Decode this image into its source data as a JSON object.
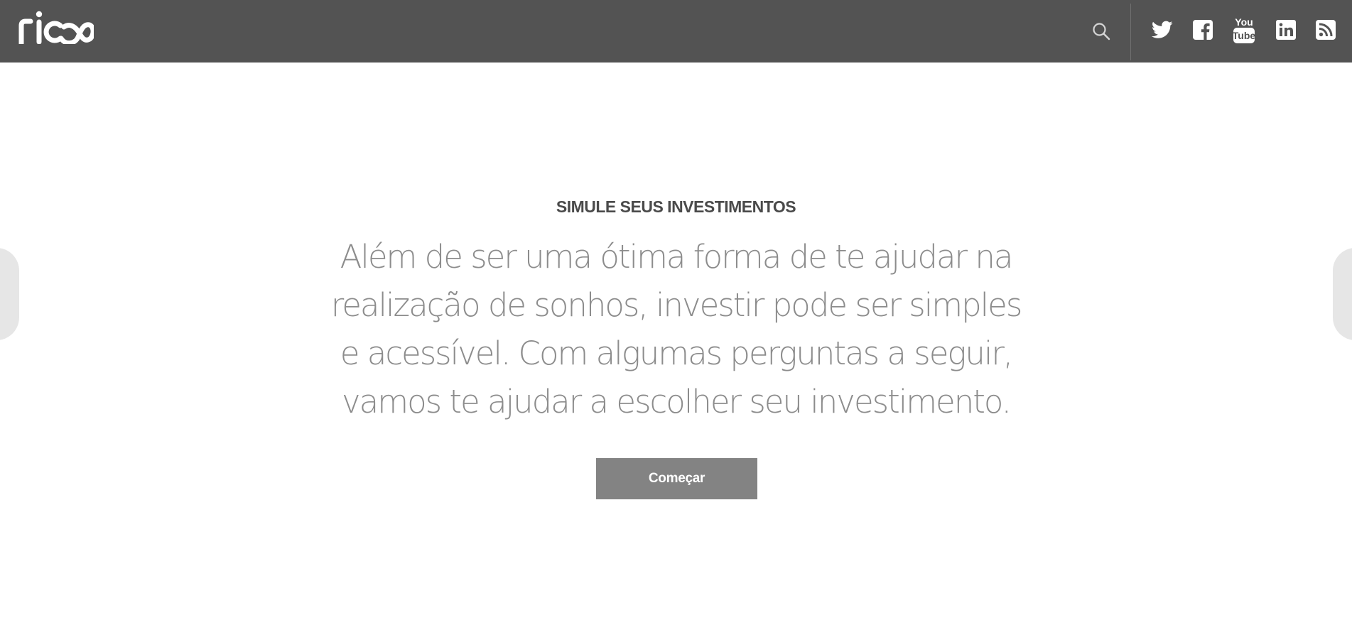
{
  "header": {
    "logo_text": "rico",
    "search_icon": "search-icon",
    "social": [
      {
        "name": "twitter",
        "icon": "twitter-icon"
      },
      {
        "name": "facebook",
        "icon": "facebook-icon",
        "glyph": "f"
      },
      {
        "name": "youtube",
        "icon": "youtube-icon",
        "line1": "You",
        "line2": "Tube"
      },
      {
        "name": "linkedin",
        "icon": "linkedin-icon",
        "glyph": "in"
      },
      {
        "name": "rss",
        "icon": "rss-icon"
      }
    ]
  },
  "hero": {
    "eyebrow": "SIMULE SEUS INVESTIMENTOS",
    "lines": [
      "Além de ser uma ótima forma de te ajudar na",
      "realização de sonhos, investir pode ser simples",
      "e acessível. Com algumas perguntas a seguir,",
      "vamos te ajudar a escolher seu investimento."
    ],
    "cta_label": "Começar"
  },
  "carousel": {
    "prev_icon": "chevron-left-icon",
    "next_icon": "chevron-right-icon"
  },
  "colors": {
    "header_bg": "#535353",
    "eyebrow": "#4a4a4a",
    "lead": "#8c8c8c",
    "cta_bg": "#838383",
    "nav_arrow_bg": "#e6e6e6"
  }
}
